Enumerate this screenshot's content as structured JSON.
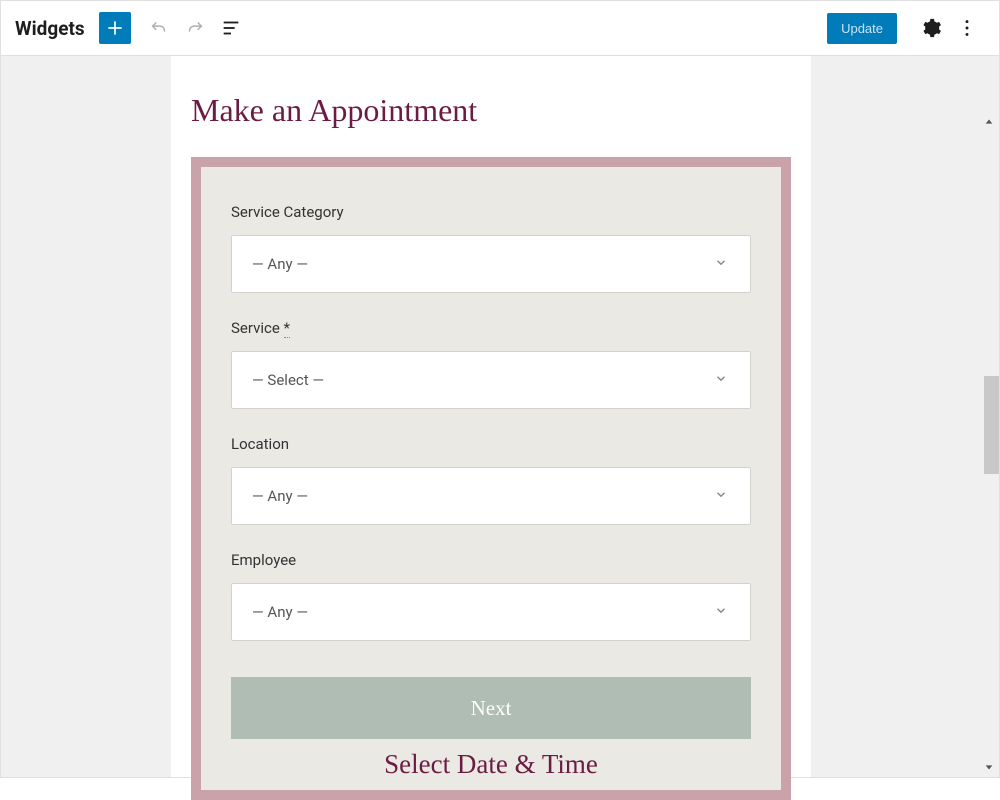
{
  "toolbar": {
    "title": "Widgets",
    "update_label": "Update"
  },
  "widget": {
    "title": "Make an Appointment",
    "fields": {
      "service_category": {
        "label": "Service Category",
        "value": "— Any —"
      },
      "service": {
        "label": "Service ",
        "value": "— Select —",
        "required": "*"
      },
      "location": {
        "label": "Location",
        "value": "— Any —"
      },
      "employee": {
        "label": "Employee",
        "value": "— Any —"
      }
    },
    "next_label": "Next",
    "section_title": "Select Date & Time"
  }
}
